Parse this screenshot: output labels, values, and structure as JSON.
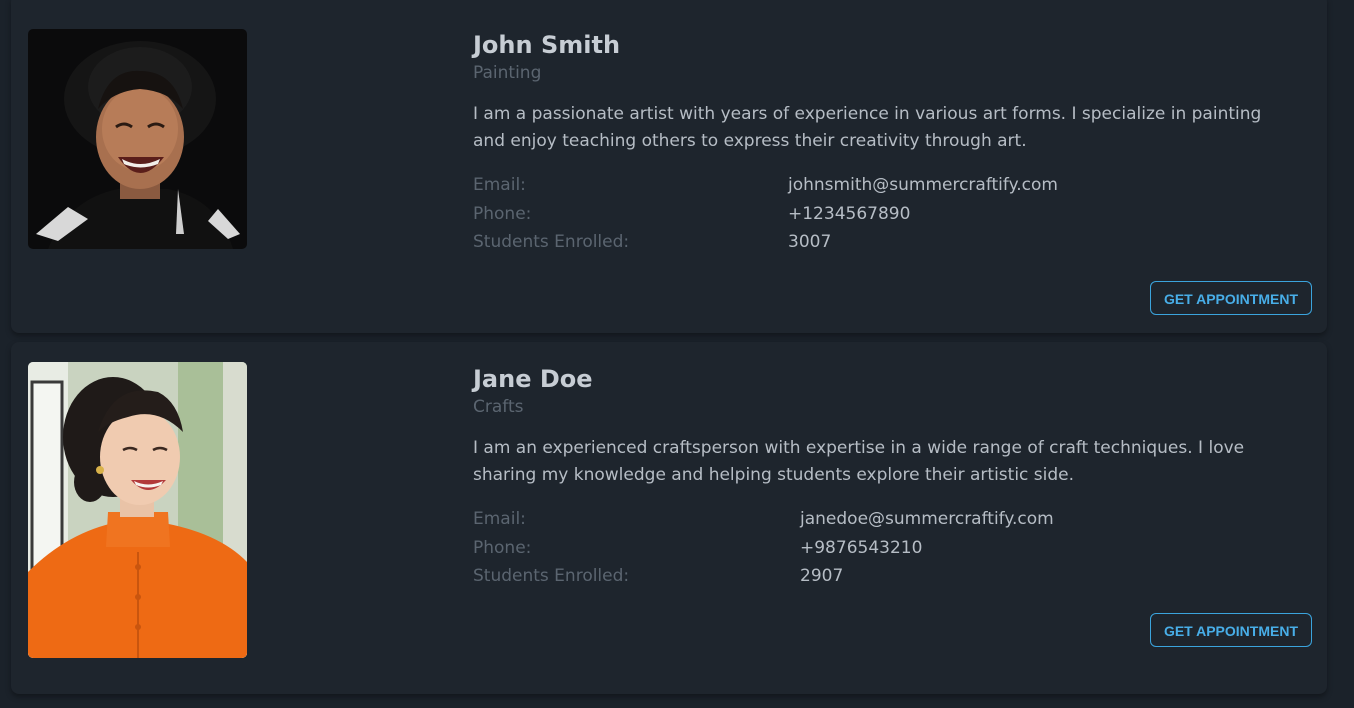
{
  "instructors": [
    {
      "name": "John Smith",
      "specialty": "Painting",
      "bio": "I am a passionate artist with years of experience in various art forms. I specialize in painting and enjoy teaching others to express their creativity through art.",
      "email_label": "Email:",
      "email": "johnsmith@summercraftify.com",
      "phone_label": "Phone:",
      "phone": "+1234567890",
      "students_label": "Students Enrolled:",
      "students": "3007",
      "button_label": "GET APPOINTMENT"
    },
    {
      "name": "Jane Doe",
      "specialty": "Crafts",
      "bio": "I am an experienced craftsperson with expertise in a wide range of craft techniques. I love sharing my knowledge and helping students explore their artistic side.",
      "email_label": "Email:",
      "email": "janedoe@summercraftify.com",
      "phone_label": "Phone:",
      "phone": "+9876543210",
      "students_label": "Students Enrolled:",
      "students": "2907",
      "button_label": "GET APPOINTMENT"
    }
  ],
  "colors": {
    "background": "#1b222a",
    "card": "#1e252d",
    "accent": "#48aee8",
    "heading": "#c7cdd4",
    "muted": "#5b6570",
    "text": "#b6bdc5"
  }
}
